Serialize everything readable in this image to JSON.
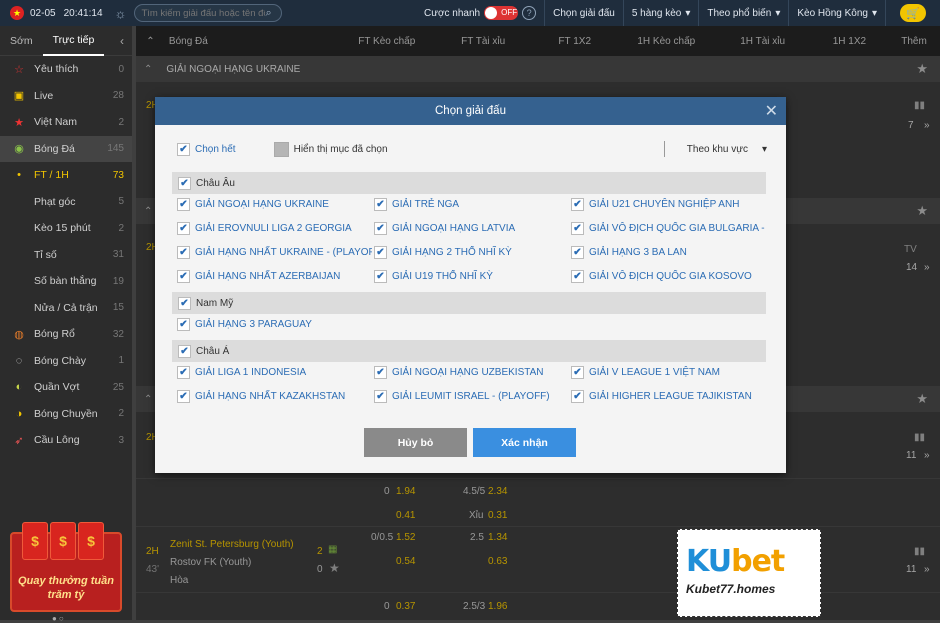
{
  "topbar": {
    "date": "02-05",
    "time": "20:41:14",
    "search_placeholder": "Tìm kiếm giải đấu hoặc tên đội",
    "quick_bet_label": "Cược nhanh",
    "toggle_label": "OFF",
    "choose_league": "Chọn giải đấu",
    "odds_rows": "5 hàng kèo",
    "popular": "Theo phổ biến",
    "odds_type": "Kèo Hồng Kông"
  },
  "sidebar": {
    "tabs": [
      "Sớm",
      "Trực tiếp"
    ],
    "items": [
      {
        "label": "Yêu thích",
        "count": "0",
        "icon": "star-icon"
      },
      {
        "label": "Live",
        "count": "28",
        "icon": "tv-icon"
      },
      {
        "label": "Việt Nam",
        "count": "2",
        "icon": "vn-flag-icon"
      },
      {
        "label": "Bóng Đá",
        "count": "145",
        "icon": "soccer-ball-icon"
      },
      {
        "label": "FT / 1H",
        "count": "73",
        "icon": "dot-icon"
      },
      {
        "label": "Phạt góc",
        "count": "5"
      },
      {
        "label": "Kèo 15 phút",
        "count": "2"
      },
      {
        "label": "Tỉ số",
        "count": "31"
      },
      {
        "label": "Số bàn thắng",
        "count": "19"
      },
      {
        "label": "Nửa / Cả trận",
        "count": "15"
      },
      {
        "label": "Bóng Rổ",
        "count": "32",
        "icon": "basketball-icon"
      },
      {
        "label": "Bóng Chày",
        "count": "1",
        "icon": "baseball-icon"
      },
      {
        "label": "Quần Vợt",
        "count": "25",
        "icon": "tennis-icon"
      },
      {
        "label": "Bóng Chuyền",
        "count": "2",
        "icon": "volleyball-icon"
      },
      {
        "label": "Cầu Lông",
        "count": "3",
        "icon": "shuttlecock-icon"
      }
    ],
    "promo": "Quay thưởng tuần trăm tỷ"
  },
  "table": {
    "headers": [
      "Bóng Đá",
      "FT Kèo chấp",
      "FT Tài xỉu",
      "FT 1X2",
      "1H Kèo chấp",
      "1H Tài xỉu",
      "1H 1X2",
      "Thêm"
    ],
    "league1": "GIẢI NGOẠI HẠNG UKRAINE",
    "match": {
      "period": "2H",
      "minute": "43'",
      "home": "Zenit St. Petersburg (Youth)",
      "away": "Rostov FK (Youth)",
      "draw": "Hòa",
      "home_score": "2",
      "away_score": "0",
      "hdp1": "0/0.5",
      "hdp1_odd": "1.52",
      "hdp1_odd2": "0.54",
      "ou1": "2.5",
      "ou1_odd": "1.34",
      "ou1_odd2": "0.63",
      "more": "11"
    },
    "row_above": {
      "hdp": "0",
      "hdp_odd": "1.94",
      "hdp_odd2": "0.41",
      "ou": "4.5/5",
      "ou_odd": "2.34",
      "ou_label": "Xỉu",
      "ou_odd2": "0.31"
    },
    "row_below": {
      "hdp": "0",
      "hdp_odd": "0.37",
      "ou": "2.5/3",
      "ou_odd": "1.96"
    },
    "side_counts": [
      "7",
      "14",
      "11"
    ],
    "tv": "TV"
  },
  "modal": {
    "title": "Chọn giải đấu",
    "select_all": "Chọn hết",
    "show_selected": "Hiển thị mục đã chọn",
    "by_region": "Theo khu vực",
    "regions": [
      {
        "name": "Châu Âu",
        "leagues": [
          "GIẢI NGOẠI HẠNG UKRAINE",
          "GIẢI TRẺ NGA",
          "GIẢI U21 CHUYÊN NGHIỆP ANH",
          "GIẢI EROVNULI LIGA 2 GEORGIA",
          "GIẢI NGOẠI HẠNG LATVIA",
          "GIẢI VÔ ĐỊCH QUỐC GIA BULGARIA - (PLA...",
          "GIẢI HẠNG NHẤT UKRAINE - (PLAYOFF)",
          "GIẢI HẠNG 2 THỔ NHĨ KỲ",
          "GIẢI HẠNG 3 BA LAN",
          "GIẢI HẠNG NHẤT AZERBAIJAN",
          "GIẢI U19 THỔ NHĨ KỲ",
          "GIẢI VÔ ĐỊCH QUỐC GIA KOSOVO"
        ]
      },
      {
        "name": "Nam Mỹ",
        "leagues": [
          "GIẢI HẠNG 3 PARAGUAY"
        ]
      },
      {
        "name": "Châu Á",
        "leagues": [
          "GIẢI LIGA 1 INDONESIA",
          "GIẢI NGOẠI HẠNG UZBEKISTAN",
          "GIẢI V LEAGUE 1 VIỆT NAM",
          "GIẢI HẠNG NHẤT KAZAKHSTAN",
          "GIẢI LEUMIT ISRAEL - (PLAYOFF)",
          "GIẢI HIGHER LEAGUE TAJIKISTAN"
        ]
      }
    ],
    "cancel": "Hủy bỏ",
    "confirm": "Xác nhận"
  },
  "watermark": {
    "logo_ku": "KU",
    "logo_bet": "bet",
    "url": "Kubet77.homes"
  }
}
